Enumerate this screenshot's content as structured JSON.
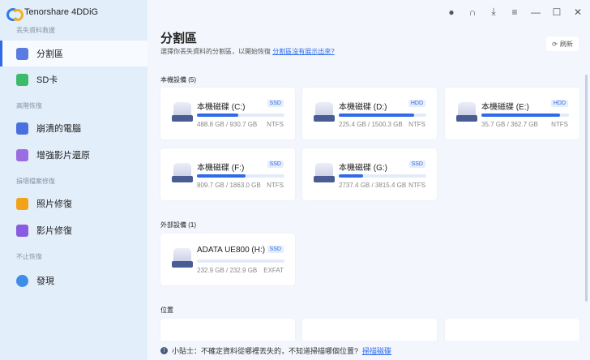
{
  "app": {
    "title": "Tenorshare 4DDiG"
  },
  "sidebar": {
    "sections": [
      "丟失資料救援",
      "高階恢復",
      "損壞檔案修復",
      "不止恢復"
    ],
    "items": [
      {
        "label": "分割區",
        "color": "#5a7be0"
      },
      {
        "label": "SD卡",
        "color": "#3dbb6a"
      },
      {
        "label": "崩潰的電腦",
        "color": "#4a6fe0"
      },
      {
        "label": "增強影片還原",
        "color": "#9a6ee0"
      },
      {
        "label": "照片修復",
        "color": "#f3a21a"
      },
      {
        "label": "影片修復",
        "color": "#8a5ae0"
      },
      {
        "label": "發現",
        "color": "#3f8de8"
      }
    ]
  },
  "window": {
    "icons": [
      "chat-bot-icon",
      "headset-icon",
      "download-icon",
      "menu-icon",
      "minimize-icon",
      "maximize-icon",
      "close-icon"
    ]
  },
  "main": {
    "title": "分割區",
    "subtitle": "選擇你丟失資料的分割區，以開始恢復",
    "subtitle_link": "分割區沒有展示出來?",
    "refresh": "刷新",
    "local_label": "本機設備 (5)",
    "external_label": "外部設備 (1)",
    "location_label": "位置",
    "local": [
      {
        "name": "本機磁碟 (C:)",
        "type": "SSD",
        "size": "488.8 GB / 930.7 GB",
        "fs": "NTFS",
        "fill": 0.47
      },
      {
        "name": "本機磁碟 (D:)",
        "type": "HDD",
        "size": "225.4 GB / 1500.3 GB",
        "fs": "NTFS",
        "fill": 0.86
      },
      {
        "name": "本機磁碟 (E:)",
        "type": "HDD",
        "size": "35.7 GB / 362.7 GB",
        "fs": "NTFS",
        "fill": 0.9
      },
      {
        "name": "本機磁碟 (F:)",
        "type": "SSD",
        "size": "809.7 GB / 1863.0 GB",
        "fs": "NTFS",
        "fill": 0.56
      },
      {
        "name": "本機磁碟 (G:)",
        "type": "SSD",
        "size": "2737.4 GB / 3815.4 GB",
        "fs": "NTFS",
        "fill": 0.28
      }
    ],
    "external": [
      {
        "name": "ADATA UE800 (H:)",
        "type": "SSD",
        "size": "232.9 GB / 232.9 GB",
        "fs": "EXFAT",
        "fill": 0
      }
    ]
  },
  "tip": {
    "text": "小貼士：不確定資料從哪裡丟失的，不知道掃描哪個位置?",
    "link": "掃描磁碟"
  }
}
